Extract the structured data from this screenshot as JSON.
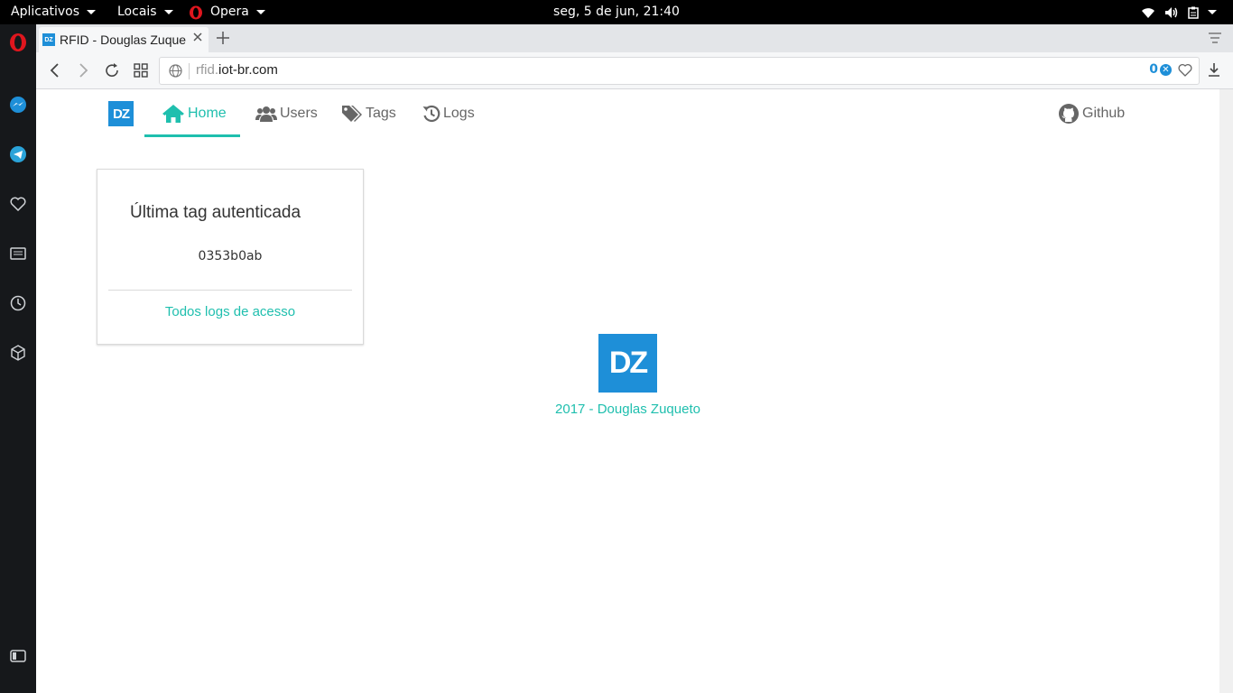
{
  "desktop": {
    "menus": [
      "Aplicativos",
      "Locais",
      "Opera"
    ],
    "clock": "seg,  5 de jun, 21:40"
  },
  "browser": {
    "tab_title": "RFID - Douglas Zuqueto",
    "favicon_text": "DZ",
    "url_subdomain": "rfid.",
    "url_domain": "iot-br.com",
    "adblock_count": "0"
  },
  "nav": {
    "logo": "DZ",
    "items": [
      {
        "label": "Home",
        "icon": "home-icon",
        "active": true
      },
      {
        "label": "Users",
        "icon": "users-icon",
        "active": false
      },
      {
        "label": "Tags",
        "icon": "tags-icon",
        "active": false
      },
      {
        "label": "Logs",
        "icon": "history-icon",
        "active": false
      }
    ],
    "github": "Github"
  },
  "card": {
    "title": "Última tag autenticada",
    "value": "0353b0ab",
    "link": "Todos logs de acesso"
  },
  "footer": {
    "logo": "DZ",
    "text": "2017 - Douglas Zuqueto"
  },
  "colors": {
    "accent": "#1fbfae",
    "brand_blue": "#1e8fd8"
  }
}
